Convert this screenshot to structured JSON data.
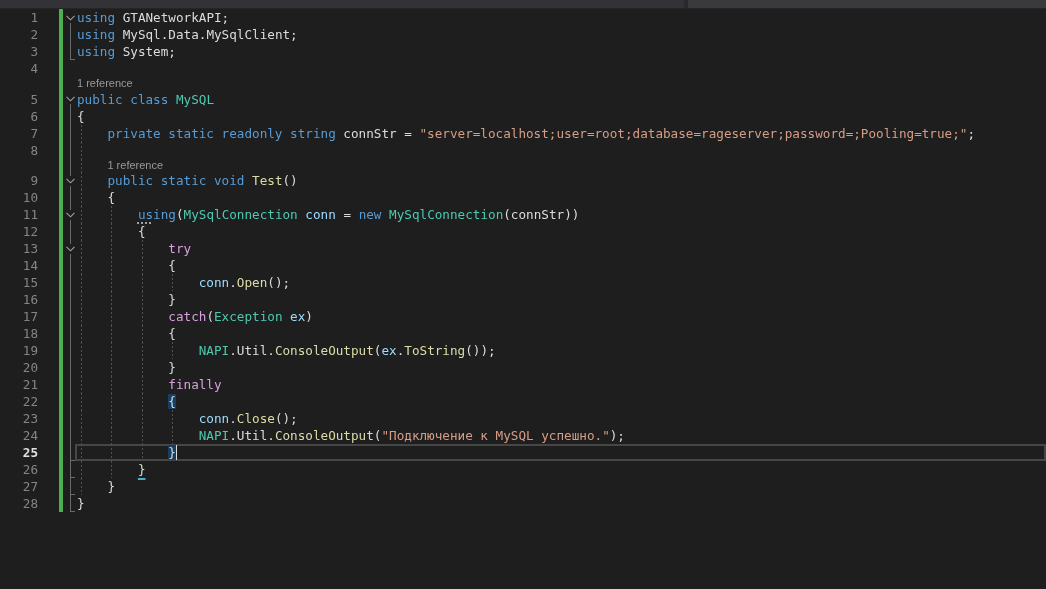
{
  "editor": {
    "lines": [
      {
        "number": "1",
        "changed": true,
        "current": false,
        "expanded": true,
        "tokens": [
          {
            "text": "using",
            "kind": "keyword"
          },
          {
            "text": " GTANetworkAPI;",
            "kind": "plain"
          }
        ]
      },
      {
        "number": "2",
        "changed": true,
        "current": false,
        "tokens": [
          {
            "text": "using",
            "kind": "keyword"
          },
          {
            "text": " MySql.Data.MySqlClient;",
            "kind": "plain"
          }
        ]
      },
      {
        "number": "3",
        "changed": true,
        "current": false,
        "fold_end": true,
        "tokens": [
          {
            "text": "using",
            "kind": "keyword"
          },
          {
            "text": " System;",
            "kind": "plain"
          }
        ]
      },
      {
        "number": "4",
        "changed": true,
        "current": false
      },
      {
        "number": "5",
        "codelens": "1 reference",
        "changed": true,
        "current": false,
        "expanded": true,
        "tokens": [
          {
            "text": "public class ",
            "kind": "keyword"
          },
          {
            "text": "MySQL",
            "kind": "type"
          }
        ]
      },
      {
        "number": "6",
        "changed": true,
        "current": false,
        "tokens": [
          {
            "text": "{",
            "kind": "plain"
          }
        ],
        "children": [
          {
            "number": "7",
            "changed": true,
            "current": false,
            "tokens": [
              {
                "text": "private static readonly string ",
                "kind": "keyword"
              },
              {
                "text": "connStr = ",
                "kind": "plain"
              },
              {
                "text": "\"server=localhost;user=root;database=rageserver;password=;Pooling=true;\"",
                "kind": "string"
              },
              {
                "text": ";",
                "kind": "plain"
              }
            ]
          },
          {
            "number": "8",
            "changed": true,
            "current": false
          },
          {
            "number": "9",
            "codelens": "1 reference",
            "changed": true,
            "current": false,
            "expanded": true,
            "tokens": [
              {
                "text": "public static void ",
                "kind": "keyword"
              },
              {
                "text": "Test",
                "kind": "method"
              },
              {
                "text": "()",
                "kind": "plain"
              }
            ]
          },
          {
            "number": "10",
            "changed": true,
            "current": false,
            "tokens": [
              {
                "text": "{",
                "kind": "plain"
              }
            ],
            "children": [
              {
                "number": "11",
                "changed": true,
                "current": false,
                "expanded": true,
                "tokens": [
                  {
                    "text": "us",
                    "kind": "keyword-suggested"
                  },
                  {
                    "text": "ing",
                    "kind": "keyword"
                  },
                  {
                    "text": "(",
                    "kind": "plain"
                  },
                  {
                    "text": "MySqlConnection ",
                    "kind": "type"
                  },
                  {
                    "text": "conn",
                    "kind": "local"
                  },
                  {
                    "text": " = ",
                    "kind": "plain"
                  },
                  {
                    "text": "new ",
                    "kind": "keyword"
                  },
                  {
                    "text": "MySqlConnection",
                    "kind": "type"
                  },
                  {
                    "text": "(connStr))",
                    "kind": "plain"
                  }
                ]
              },
              {
                "number": "12",
                "changed": true,
                "current": false,
                "tokens": [
                  {
                    "text": "{",
                    "kind": "plain"
                  }
                ],
                "children": [
                  {
                    "number": "13",
                    "changed": true,
                    "current": false,
                    "expanded": true,
                    "tokens": [
                      {
                        "text": "try",
                        "kind": "control"
                      }
                    ]
                  },
                  {
                    "number": "14",
                    "changed": true,
                    "current": false,
                    "tokens": [
                      {
                        "text": "{",
                        "kind": "plain"
                      }
                    ],
                    "children": [
                      {
                        "number": "15",
                        "changed": true,
                        "current": false,
                        "tokens": [
                          {
                            "text": "conn",
                            "kind": "local"
                          },
                          {
                            "text": ".",
                            "kind": "plain"
                          },
                          {
                            "text": "Open",
                            "kind": "method"
                          },
                          {
                            "text": "();",
                            "kind": "plain"
                          }
                        ]
                      }
                    ]
                  },
                  {
                    "number": "16",
                    "changed": true,
                    "current": false,
                    "tokens": [
                      {
                        "text": "}",
                        "kind": "plain"
                      }
                    ]
                  },
                  {
                    "number": "17",
                    "changed": true,
                    "current": false,
                    "tokens": [
                      {
                        "text": "catch",
                        "kind": "control"
                      },
                      {
                        "text": "(",
                        "kind": "plain"
                      },
                      {
                        "text": "Exception ",
                        "kind": "type"
                      },
                      {
                        "text": "ex",
                        "kind": "local"
                      },
                      {
                        "text": ")",
                        "kind": "plain"
                      }
                    ]
                  },
                  {
                    "number": "18",
                    "changed": true,
                    "current": false,
                    "tokens": [
                      {
                        "text": "{",
                        "kind": "plain"
                      }
                    ],
                    "children": [
                      {
                        "number": "19",
                        "changed": true,
                        "current": false,
                        "tokens": [
                          {
                            "text": "NAPI",
                            "kind": "type"
                          },
                          {
                            "text": ".Util.",
                            "kind": "plain"
                          },
                          {
                            "text": "ConsoleOutput",
                            "kind": "method"
                          },
                          {
                            "text": "(",
                            "kind": "plain"
                          },
                          {
                            "text": "ex",
                            "kind": "local"
                          },
                          {
                            "text": ".",
                            "kind": "plain"
                          },
                          {
                            "text": "ToString",
                            "kind": "method"
                          },
                          {
                            "text": "());",
                            "kind": "plain"
                          }
                        ]
                      }
                    ]
                  },
                  {
                    "number": "20",
                    "changed": true,
                    "current": false,
                    "tokens": [
                      {
                        "text": "}",
                        "kind": "plain"
                      }
                    ]
                  },
                  {
                    "number": "21",
                    "changed": true,
                    "current": false,
                    "tokens": [
                      {
                        "text": "finally",
                        "kind": "control"
                      }
                    ]
                  },
                  {
                    "number": "22",
                    "changed": true,
                    "current": false,
                    "tokens": [
                      {
                        "text": "{",
                        "kind": "brace-match"
                      }
                    ],
                    "children": [
                      {
                        "number": "23",
                        "changed": true,
                        "current": false,
                        "tokens": [
                          {
                            "text": "conn",
                            "kind": "local"
                          },
                          {
                            "text": ".",
                            "kind": "plain"
                          },
                          {
                            "text": "Close",
                            "kind": "method"
                          },
                          {
                            "text": "();",
                            "kind": "plain"
                          }
                        ]
                      },
                      {
                        "number": "24",
                        "changed": true,
                        "current": false,
                        "tokens": [
                          {
                            "text": "NAPI",
                            "kind": "type"
                          },
                          {
                            "text": ".Util.",
                            "kind": "plain"
                          },
                          {
                            "text": "ConsoleOutput",
                            "kind": "method"
                          },
                          {
                            "text": "(",
                            "kind": "plain"
                          },
                          {
                            "text": "\"Подключение к MySQL успешно.\"",
                            "kind": "string"
                          },
                          {
                            "text": ");",
                            "kind": "plain"
                          }
                        ]
                      }
                    ]
                  },
                  {
                    "number": "25",
                    "changed": true,
                    "current": true,
                    "caret": true,
                    "fold_end": true,
                    "tokens": [
                      {
                        "text": "}",
                        "kind": "brace-match"
                      }
                    ]
                  }
                ]
              },
              {
                "number": "26",
                "changed": true,
                "current": false,
                "fold_end": true,
                "tokens": [
                  {
                    "text": "}",
                    "kind": "plain-underlined"
                  }
                ]
              }
            ]
          },
          {
            "number": "27",
            "changed": true,
            "current": false,
            "fold_end": true,
            "tokens": [
              {
                "text": "}",
                "kind": "plain"
              }
            ]
          }
        ]
      },
      {
        "number": "28",
        "changed": true,
        "current": false,
        "fold_end": true,
        "tokens": [
          {
            "text": "}",
            "kind": "plain"
          }
        ]
      }
    ]
  }
}
